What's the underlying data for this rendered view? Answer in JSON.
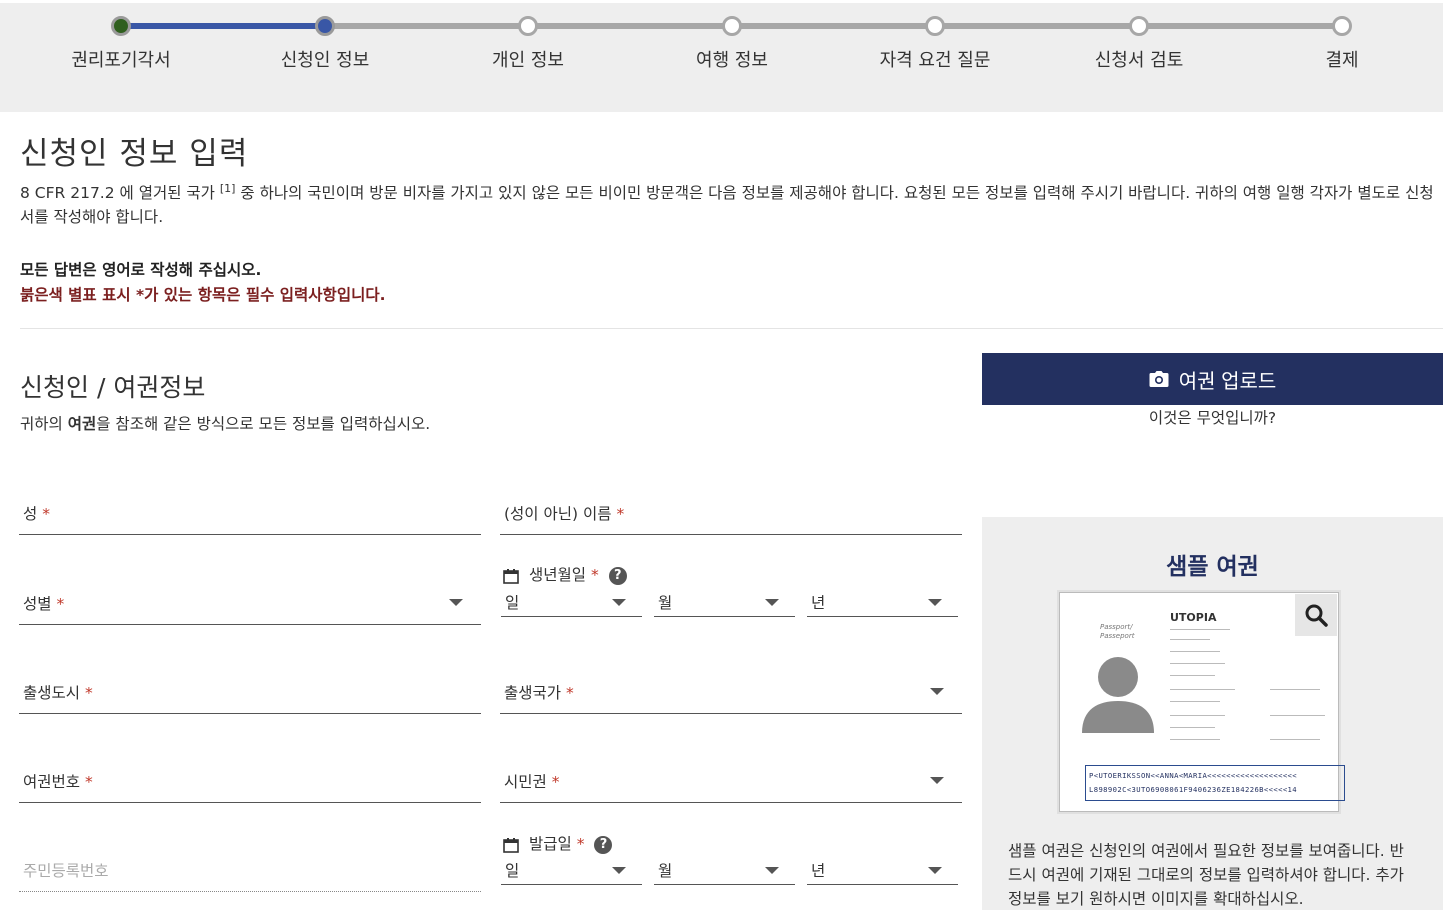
{
  "steps": [
    {
      "label": "권리포기각서",
      "state": "done"
    },
    {
      "label": "신청인 정보",
      "state": "active"
    },
    {
      "label": "개인 정보",
      "state": "todo"
    },
    {
      "label": "여행 정보",
      "state": "todo"
    },
    {
      "label": "자격 요건 질문",
      "state": "todo"
    },
    {
      "label": "신청서 검토",
      "state": "todo"
    },
    {
      "label": "결제",
      "state": "todo"
    }
  ],
  "page": {
    "title": "신청인 정보 입력",
    "intro_before": "8 CFR 217.2 에 열거된 국가 ",
    "intro_ref": "[1]",
    "intro_after": " 중 하나의 국민이며 방문 비자를 가지고 있지 않은 모든 비이민 방문객은 다음 정보를 제공해야 합니다. 요청된 모든 정보를 입력해 주시기 바랍니다. 귀하의 여행 일행 각자가 별도로 신청서를 작성해야 합니다.",
    "note_english": "모든 답변은 영어로 작성해 주십시오.",
    "note_required": "붉은색 별표 표시 *가 있는 항목은 필수 입력사항입니다."
  },
  "section": {
    "title": "신청인 / 여권정보",
    "sub_before": "귀하의 ",
    "sub_bold": "여권",
    "sub_after": "을 참조해 같은 방식으로 모든 정보를 입력하십시오."
  },
  "fields": {
    "surname": "성",
    "given_name": "(성이 아닌) 이름",
    "gender": "성별",
    "birth_date": "생년월일",
    "birth_city": "출생도시",
    "birth_country": "출생국가",
    "passport_number": "여권번호",
    "citizenship": "시민권",
    "national_id": "주민등록번호",
    "issue_date": "발급일",
    "required_mark": "*",
    "day": "일",
    "month": "월",
    "year": "년"
  },
  "upload": {
    "button_label": "여권 업로드",
    "whatis": "이것은 무엇입니까?"
  },
  "sample": {
    "title": "샘플 여권",
    "country": "UTOPIA",
    "doc_label": "Passport/ Passeport",
    "mrz_line1": "P<UTOERIKSSON<<ANNA<MARIA<<<<<<<<<<<<<<<<<<<",
    "mrz_line2": "L898902C<3UTO6908061F9406236ZE184226B<<<<<14",
    "description": "샘플 여권은 신청인의 여권에서 필요한 정보를 보여줍니다. 반드시 여권에 기재된 그대로의 정보를 입력하셔야 합니다. 추가 정보를 보기 원하시면 이미지를 확대하십시오."
  },
  "colors": {
    "brand_navy": "#233060",
    "step_blue": "#3957a6",
    "required_red": "#c0392b",
    "note_red": "#7b1f1f"
  }
}
